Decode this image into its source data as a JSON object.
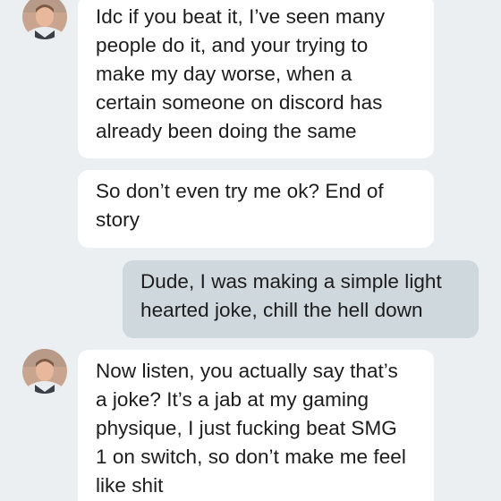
{
  "conversation": {
    "messages": [
      {
        "direction": "incoming",
        "lines": [
          "Idc if you beat it, I’ve seen many",
          "people do it, and your trying to",
          "make my day worse, when a",
          "certain someone on discord has",
          "already been doing the same"
        ]
      },
      {
        "direction": "incoming",
        "lines": [
          "So don’t even try me ok? End of",
          "story"
        ]
      },
      {
        "direction": "outgoing",
        "lines": [
          "Dude, I was making a simple light",
          "hearted joke, chill the hell down"
        ]
      },
      {
        "direction": "incoming",
        "lines": [
          "Now listen, you actually say that’s",
          "a joke? It’s a jab at my gaming",
          "physique, I just fucking beat SMG",
          "1 on switch, so don’t make me feel",
          "like shit"
        ]
      }
    ]
  },
  "icons": {
    "sender_avatar": "contact-photo-avatar"
  },
  "colors": {
    "background": "#eceff1",
    "incoming_bubble": "#ffffff",
    "outgoing_bubble": "#cfd8dc",
    "text": "#1c1c1c"
  }
}
